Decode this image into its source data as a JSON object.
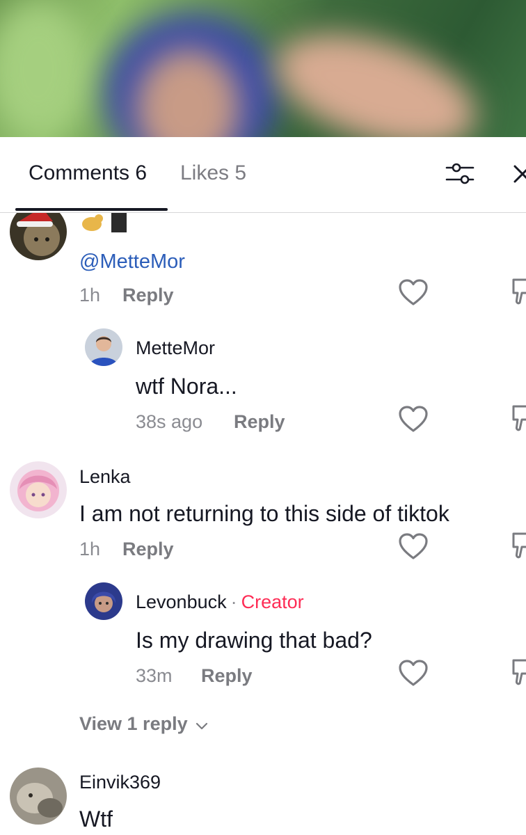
{
  "tabs": {
    "comments_label": "Comments 6",
    "likes_label": "Likes 5"
  },
  "icons": {
    "filter": "sliders-icon",
    "close": "close-icon",
    "like": "heart-outline-icon",
    "dislike": "thumbs-down-outline-icon",
    "chevron": "chevron-down-icon"
  },
  "colors": {
    "creator": "#fe2c55",
    "mention": "#2b5db9",
    "muted": "#8a8b91"
  },
  "comments": [
    {
      "mention": "@MetteMor",
      "time": "1h",
      "reply_label": "Reply",
      "replies": [
        {
          "username": "MetteMor",
          "text": "wtf Nora...",
          "time": "38s ago",
          "reply_label": "Reply"
        }
      ]
    },
    {
      "username": "Lenka",
      "text": "I am not returning to this side of tiktok",
      "time": "1h",
      "reply_label": "Reply",
      "replies": [
        {
          "username": "Levonbuck",
          "separator": "·",
          "creator_label": "Creator",
          "text": "Is my drawing that bad?",
          "time": "33m",
          "reply_label": "Reply"
        }
      ],
      "view_replies": "View 1 reply"
    },
    {
      "username": "Einvik369",
      "text": "Wtf"
    }
  ]
}
